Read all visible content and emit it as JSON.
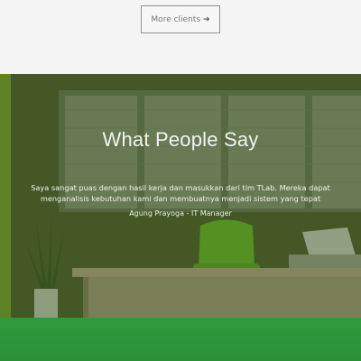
{
  "clients": {
    "more_button_label": "More clients",
    "more_button_icon": "arrow-right-icon"
  },
  "testimonial": {
    "heading": "What People Say",
    "quote": "Saya sangat puas dengan hasil kerja dan masukkan dari tim TLab. Mereka dapat menganalisis kebutuhan kami dan membuatnya menjadi sistem yang tepat",
    "author": "Agung Prayoga - IT Manager"
  },
  "colors": {
    "green_overlay": "#4a5e2e",
    "green_band": "#2f9a3c",
    "button_border": "#8f8f8f"
  }
}
